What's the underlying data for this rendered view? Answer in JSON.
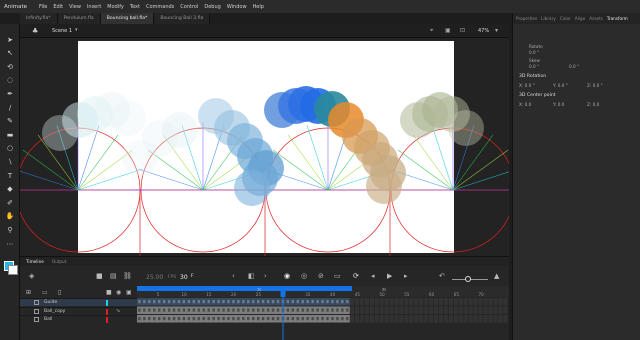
{
  "app": {
    "logo": "Animate"
  },
  "menu": [
    "File",
    "Edit",
    "View",
    "Insert",
    "Modify",
    "Text",
    "Commands",
    "Control",
    "Debug",
    "Window",
    "Help"
  ],
  "doc_tabs": [
    {
      "label": "Infinity.fla*",
      "active": false
    },
    {
      "label": "Pendulum.fla",
      "active": false
    },
    {
      "label": "Bouncing ball.fla*",
      "active": true
    },
    {
      "label": "Bouncing Ball 3.fla",
      "active": false
    }
  ],
  "scene": {
    "label": "Scene 1",
    "zoom": "47%"
  },
  "right_panel": {
    "tabs": [
      "Properties",
      "Library",
      "Color",
      "Align",
      "Assets",
      "Transform"
    ],
    "active_tab": "Transform",
    "rotate_label": "Rotate",
    "rotate_value": "0.0 °",
    "skew_label": "Skew",
    "skew_value1": "0.0 °",
    "skew_value2": "0.0 °",
    "rotation_3d_label": "3D Rotation",
    "rot_x": "X: 0.0 °",
    "rot_y": "Y: 0.0 °",
    "rot_z": "Z: 0.0 °",
    "center_3d_label": "3D Center point",
    "cx": "X: 0.0",
    "cy": "Y: 0.0",
    "cz": "Z: 0.0"
  },
  "timeline": {
    "tabs": [
      "Timeline",
      "Output"
    ],
    "active_tab": "Timeline",
    "fps": "25.00",
    "fps_unit": "FPS",
    "current_frame": "30",
    "frame_suffix": "F",
    "ruler_labels": [
      "5",
      "10",
      "15",
      "20",
      "25",
      "30",
      "35",
      "40",
      "45",
      "50",
      "55",
      "60",
      "65",
      "70"
    ],
    "ruler_top_labels": [
      "1s",
      "2s"
    ],
    "layers": [
      {
        "name": "Guide",
        "color": "#1fd1e8",
        "selected": true
      },
      {
        "name": "Ball_copy",
        "color": "#e02020",
        "selected": false
      },
      {
        "name": "Ball",
        "color": "#e02020",
        "selected": false
      }
    ],
    "playhead_frame": 30,
    "total_frames": 43
  },
  "colors": {
    "stage_bg": "#ffffff",
    "accent_blue": "#1473e6",
    "guide_red": "#e02020"
  }
}
